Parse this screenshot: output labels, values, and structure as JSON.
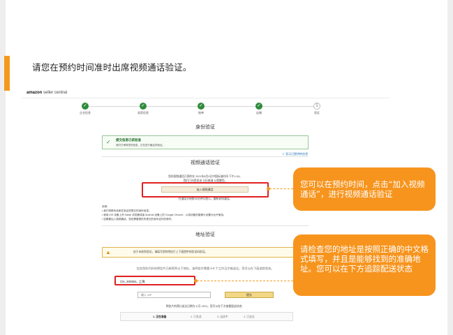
{
  "instruction": "请您在预约时间准时出席视频通话验证。",
  "seller_central": {
    "logo_brand": "amazon",
    "logo_suffix": "seller central",
    "steps": [
      {
        "label": "企业信息",
        "done": true
      },
      {
        "label": "卖家信息",
        "done": true
      },
      {
        "label": "账单",
        "done": true
      },
      {
        "label": "店铺",
        "done": true
      },
      {
        "label": "验证",
        "done": false,
        "number": "5"
      }
    ],
    "identity": {
      "title": "身份验证",
      "success_title": "提交信息已获批准",
      "success_sub": "我们已审核您的信息，正在进行最后的验证。",
      "show_link": "∨ 显示已提供的信息"
    },
    "video": {
      "title": "视频通话验证",
      "schedule_line1": "您的视频通话已预约在 2021年8月9日中国标准时间 下午1:00。",
      "schedule_line2": "我们已向您发送 日历邀请 以提醒您。",
      "join_button": "加入视频通话",
      "below_button": "在通话开始前30分钟可加入。重新安排通话。",
      "notes_heading": "说明：",
      "notes": [
        "• 我们将联系卖家并验证您提交的身份信息。",
        "• 使用 iOS 设备上的 Safari 浏览器或者 Android 设备上的 Google Chrome，以将设备的摄像头设置为允许使用。",
        "• 如果要加入视频通话，您还需要提供所提交的身份证件的原件。"
      ]
    },
    "address": {
      "title": "地址验证",
      "warning": "由于未收到验证，请填写您的明信片上下面提供的验证码验证。",
      "description": "包含您的代码的明信片已邮寄到以下地址，该明信片需要 5-8 个工作日才能送达，您可以在下面追踪状态。",
      "value": "CN, 200051, 上海",
      "zip_placeholder": "输入 ZIP",
      "submit_button": "提交",
      "eta_line": "明信片的预计送达日期为 8 月 2021，您可以在下方查看配送状态：",
      "tracking": [
        "1. 正在准备",
        "2. 已发送",
        "3. 运送中",
        "4. 已送达"
      ]
    }
  },
  "callouts": {
    "video_call": "您可以在预约时间，点击“加入视频通话”，进行视频通话验证",
    "address": "请检查您的地址是按照正确的中文格式填写，并且是能够找到的准确地址。您可以在下方追踪配送状态"
  },
  "colors": {
    "accent": "#f39a1e",
    "callout_bg": "#f7941d",
    "highlight_red": "#e02020",
    "success_green": "#2e8b3a"
  }
}
